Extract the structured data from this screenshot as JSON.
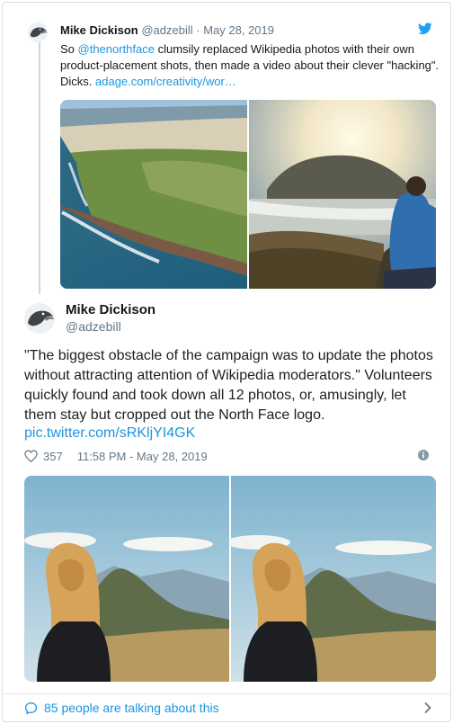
{
  "quoted_tweet": {
    "author_name": "Mike Dickison",
    "author_handle": "@adzebill",
    "separator": "·",
    "date": "May 28, 2019",
    "text_parts": [
      {
        "text": "So ",
        "link": false
      },
      {
        "text": "@thenorthface",
        "link": true
      },
      {
        "text": " clumsily replaced Wikipedia photos with their own product-placement shots, then made a video about their clever \"hacking\". Dicks. ",
        "link": false
      },
      {
        "text": "adage.com/creativity/wor…",
        "link": true
      }
    ],
    "images": [
      "coastal-aerial-photo",
      "hiker-sunset-photo"
    ]
  },
  "main_tweet": {
    "author_name": "Mike Dickison",
    "author_handle": "@adzebill",
    "text": "\"The biggest obstacle of the campaign was to update the photos without attracting attention of Wikipedia moderators.\" Volunteers quickly found and took down all 12 photos, or, amusingly, let them stay but cropped out the North Face logo.",
    "link": "pic.twitter.com/sRKljYI4GK",
    "likes": "357",
    "timestamp": "11:58 PM - May 28, 2019",
    "images": [
      "woman-mountain-photo-1",
      "woman-mountain-photo-2"
    ]
  },
  "footer": {
    "talking_label": "85 people are talking about this"
  },
  "colors": {
    "link": "#1b95e0",
    "muted": "#657786",
    "twitter_blue": "#1da1f2",
    "border": "#d8dee2"
  }
}
